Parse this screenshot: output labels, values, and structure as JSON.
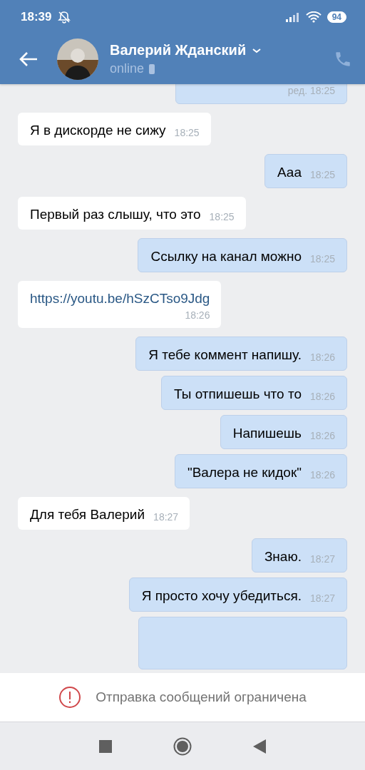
{
  "status_bar": {
    "time": "18:39",
    "battery": "94"
  },
  "header": {
    "name": "Валерий Жданский",
    "status": "online"
  },
  "messages": [
    {
      "outgoing": true,
      "kind": "partial",
      "time": "ред. 18:25"
    },
    {
      "outgoing": false,
      "kind": "text",
      "text": "Я в дискорде не сижу",
      "time": "18:25"
    },
    {
      "outgoing": true,
      "kind": "text",
      "text": "Ааа",
      "time": "18:25"
    },
    {
      "outgoing": false,
      "kind": "text",
      "text": "Первый раз слышу, что это",
      "time": "18:25"
    },
    {
      "outgoing": true,
      "kind": "text",
      "text": "Ссылку на канал можно",
      "time": "18:25"
    },
    {
      "outgoing": false,
      "kind": "link",
      "text": "https://youtu.be/hSzCTso9Jdg",
      "time": "18:26"
    },
    {
      "outgoing": true,
      "kind": "text",
      "text": "Я тебе коммент напишу.",
      "time": "18:26"
    },
    {
      "outgoing": true,
      "kind": "text",
      "text": "Ты отпишешь что то",
      "time": "18:26"
    },
    {
      "outgoing": true,
      "kind": "text",
      "text": "Напишешь",
      "time": "18:26"
    },
    {
      "outgoing": true,
      "kind": "text",
      "text": "\"Валера не кидок\"",
      "time": "18:26"
    },
    {
      "outgoing": false,
      "kind": "text",
      "text": "Для тебя Валерий",
      "time": "18:27"
    },
    {
      "outgoing": true,
      "kind": "text",
      "text": "Знаю.",
      "time": "18:27"
    },
    {
      "outgoing": true,
      "kind": "text",
      "text": "Я просто хочу убедиться.",
      "time": "18:27"
    },
    {
      "outgoing": true,
      "kind": "partial"
    }
  ],
  "notice": "Отправка сообщений ограничена"
}
